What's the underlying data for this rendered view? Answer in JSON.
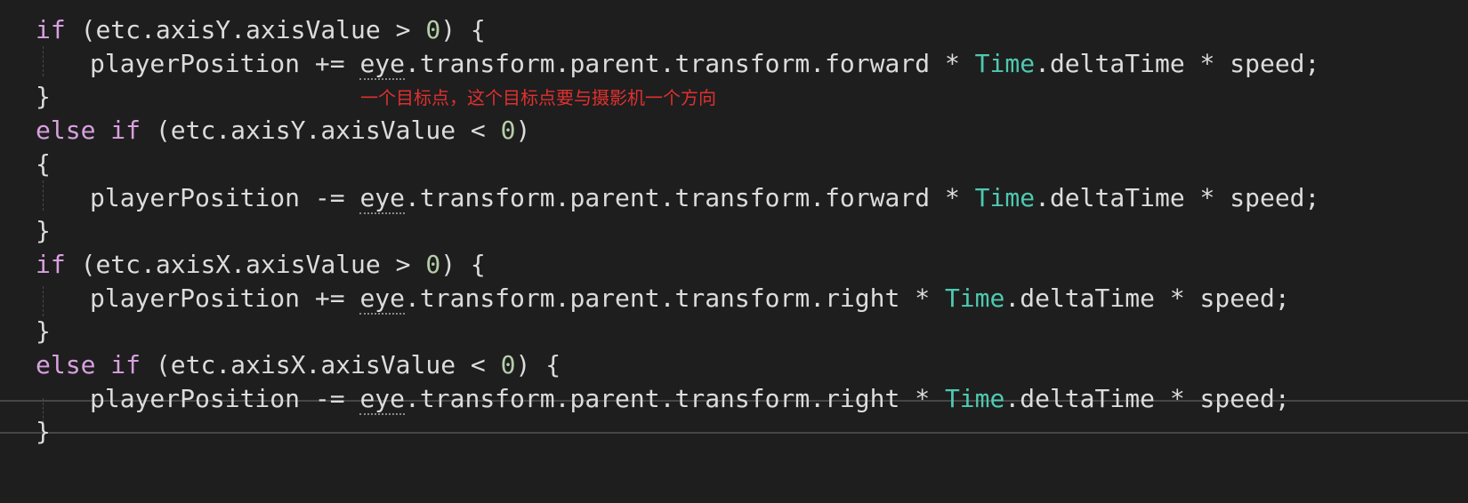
{
  "editor": {
    "annotation": "一个目标点，这个目标点要与摄影机一个方向",
    "tokens": {
      "if": "if",
      "else": "else",
      "open_paren": "(",
      "close_paren": ")",
      "open_brace": "{",
      "close_brace": "}",
      "etc": "etc",
      "dot": ".",
      "axisY": "axisY",
      "axisX": "axisX",
      "axisValue": "axisValue",
      "gt": ">",
      "lt": "<",
      "zero": "0",
      "playerPosition": "playerPosition",
      "plus_eq": "+=",
      "minus_eq": "-=",
      "eye": "eye",
      "transform": "transform",
      "parent": "parent",
      "forward": "forward",
      "right": "right",
      "star": "*",
      "Time": "Time",
      "deltaTime": "deltaTime",
      "speed": "speed",
      "semicolon": ";"
    }
  }
}
